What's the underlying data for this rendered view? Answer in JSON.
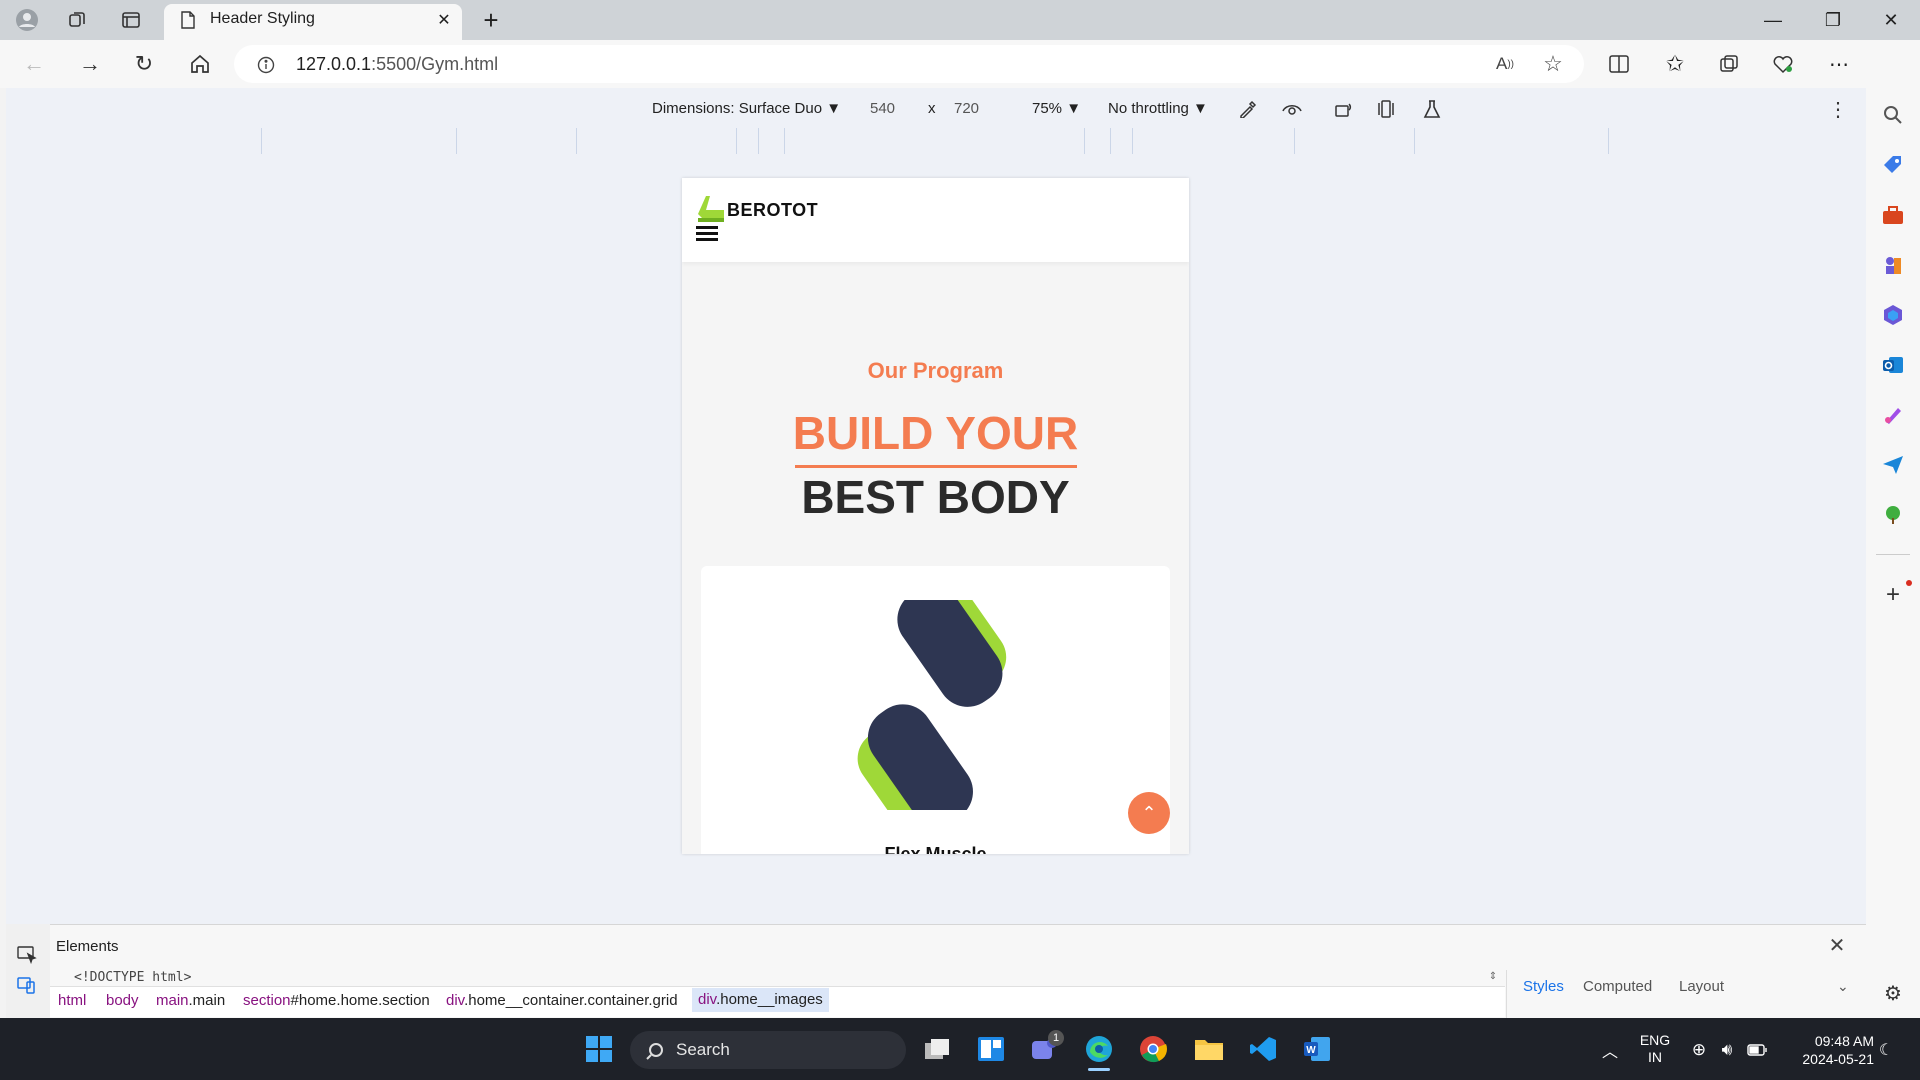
{
  "browser": {
    "tab_title": "Header Styling",
    "new_tab": "+",
    "close_tab": "✕",
    "url_host": "127.0.0.1",
    "url_rest": ":5500/Gym.html",
    "window_controls": {
      "minimize": "—",
      "restore": "❐",
      "close": "✕"
    }
  },
  "device_toolbar": {
    "dimensions": "Dimensions: Surface Duo",
    "width": "540",
    "times": "x",
    "height": "720",
    "zoom": "75%",
    "throttling": "No throttling"
  },
  "site": {
    "brand": "BEROTOT",
    "program_label": "Our Program",
    "title_line1": "BUILD YOUR",
    "title_line2": "BEST BODY",
    "card_title": "Flex Muscle",
    "scroll_up": "⌃"
  },
  "devtools": {
    "elements_tab": "Elements",
    "doctype": "<!DOCTYPE html>",
    "breadcrumbs": [
      {
        "tag": "html",
        "rest": ""
      },
      {
        "tag": "body",
        "rest": ""
      },
      {
        "tag": "main",
        "rest": ".main"
      },
      {
        "tag": "section",
        "rest": "#home.home.section"
      },
      {
        "tag": "div",
        "rest": ".home__container.container.grid"
      },
      {
        "tag": "div",
        "rest": ".home__images"
      }
    ],
    "style_tabs": [
      "Styles",
      "Computed",
      "Layout"
    ]
  },
  "taskbar": {
    "search_label": "Search",
    "teams_badge": "1",
    "lang_top": "ENG",
    "lang_bottom": "IN",
    "time": "09:48 AM",
    "date": "2024-05-21"
  },
  "colors": {
    "accent": "#f47c50",
    "dumbbell": "#2e3652",
    "dumbbell_tip": "#9fd838",
    "devtools_blue": "#1a73e8"
  }
}
